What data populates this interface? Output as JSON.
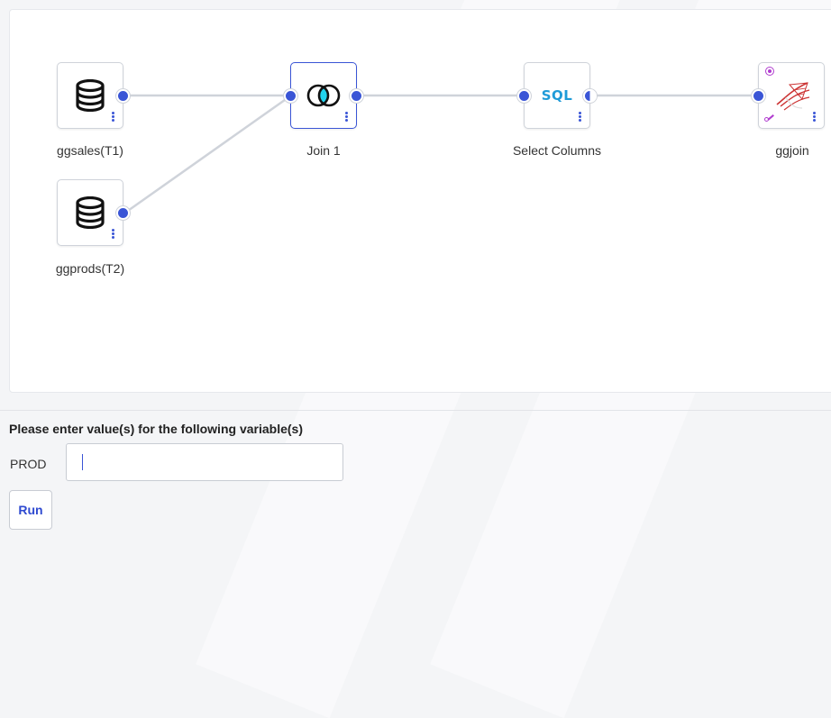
{
  "flow": {
    "nodes": [
      {
        "label": "ggsales(T1)",
        "icon": "database-icon"
      },
      {
        "label": "ggprods(T2)",
        "icon": "database-icon"
      },
      {
        "label": "Join 1",
        "icon": "join-venn-icon"
      },
      {
        "label": "Select Columns",
        "icon": "sql-icon",
        "badge": "SQL"
      },
      {
        "label": "ggjoin",
        "icon": "sql-server-icon"
      }
    ]
  },
  "variables": {
    "prompt": "Please enter value(s) for the following variable(s)",
    "fields": [
      {
        "name": "PROD",
        "value": ""
      }
    ]
  },
  "actions": {
    "run_label": "Run"
  },
  "colors": {
    "accent": "#3a55d6",
    "sql": "#1f9bd8",
    "edge": "#cfd3da"
  }
}
